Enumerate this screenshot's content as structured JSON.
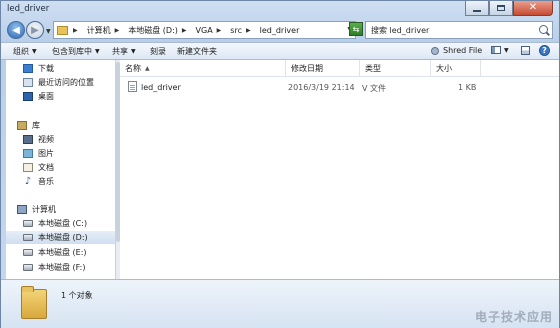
{
  "window": {
    "title": "led_driver",
    "controls": [
      "minimize-icon",
      "maximize-icon",
      "close-icon"
    ]
  },
  "address": {
    "crumbs": [
      "计算机",
      "本地磁盘 (D:)",
      "VGA",
      "src",
      "led_driver"
    ]
  },
  "search": {
    "placeholder": "搜索 led_driver"
  },
  "toolbar": {
    "organize": "组织",
    "include_in_library": "包含到库中",
    "share": "共享",
    "burn": "刻录",
    "new_folder": "新建文件夹",
    "shred_file": "Shred File"
  },
  "sidebar": {
    "favorites": [
      {
        "label": "下载",
        "icon": "download-folder-icon"
      },
      {
        "label": "最近访问的位置",
        "icon": "recent-places-icon"
      },
      {
        "label": "桌面",
        "icon": "desktop-icon"
      }
    ],
    "libraries_header": "库",
    "libraries": [
      {
        "label": "视频",
        "icon": "video-library-icon"
      },
      {
        "label": "图片",
        "icon": "pictures-library-icon"
      },
      {
        "label": "文档",
        "icon": "documents-library-icon"
      },
      {
        "label": "音乐",
        "icon": "music-library-icon"
      }
    ],
    "computer_header": "计算机",
    "drives": [
      {
        "label": "本地磁盘 (C:)"
      },
      {
        "label": "本地磁盘 (D:)",
        "selected": true
      },
      {
        "label": "本地磁盘 (E:)"
      },
      {
        "label": "本地磁盘 (F:)"
      }
    ]
  },
  "file_list": {
    "columns": {
      "name": "名称",
      "modified": "修改日期",
      "type": "类型",
      "size": "大小"
    },
    "rows": [
      {
        "name": "led_driver",
        "modified": "2016/3/19 21:14",
        "type": "V 文件",
        "size": "1 KB"
      }
    ]
  },
  "details": {
    "count": "1 个对象"
  },
  "watermark": "电子技术应用"
}
